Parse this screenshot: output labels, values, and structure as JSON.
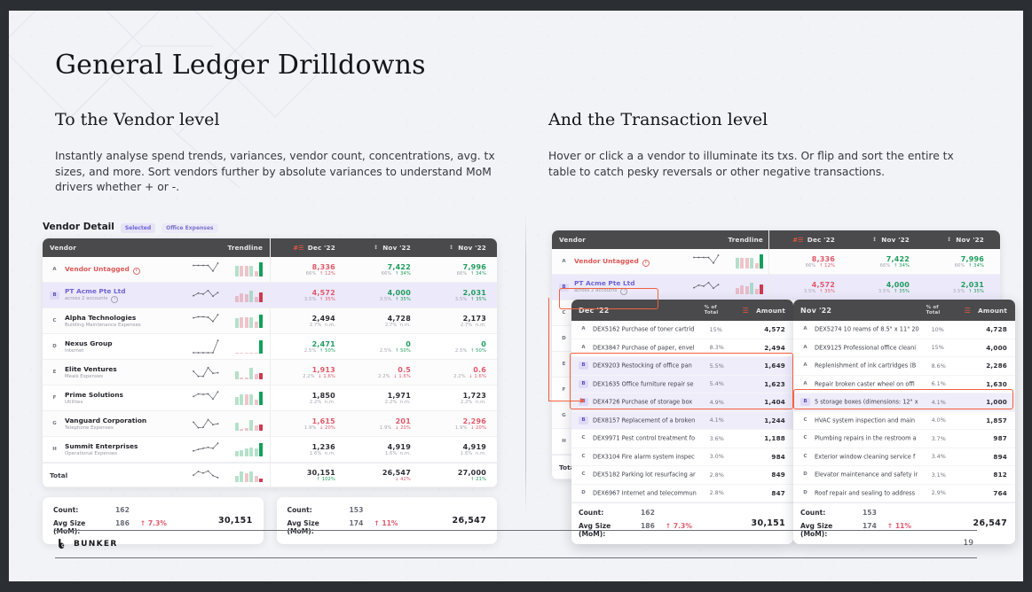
{
  "slide": {
    "title": "General Ledger Drilldowns",
    "page_number": "19",
    "brand": "BUNKER"
  },
  "left_col": {
    "heading": "To the Vendor level",
    "body": "Instantly analyse spend trends, variances, vendor count, concentrations, avg. tx sizes, and more. Sort vendors further by absolute variances to understand MoM drivers whether + or -."
  },
  "right_col": {
    "heading": "And the Transaction level",
    "body": "Hover or click a a vendor to illuminate its txs. Or flip and sort the entire tx table to catch pesky reversals or other negative transactions."
  },
  "vendor_detail": {
    "title": "Vendor Detail",
    "pill_selected": "Selected",
    "pill_category": "Office Expenses",
    "columns": {
      "vendor": "Vendor",
      "trendline": "Trendline",
      "col1": "Dec '22",
      "col2": "Nov '22",
      "col3": "Nov '22"
    },
    "sort_icon": "filter-sort-icon",
    "rows": [
      {
        "letter": "A",
        "name": "Vendor Untagged",
        "sub": "",
        "style": "red",
        "info": true,
        "c1": {
          "v": "8,336",
          "pct": "66%",
          "d": "↑ 12%",
          "tone": "red"
        },
        "c2": {
          "v": "7,422",
          "pct": "66%",
          "d": "↑ 34%",
          "tone": "green"
        },
        "c3": {
          "v": "7,996",
          "pct": "66%",
          "d": "↑ 34%",
          "tone": "green"
        }
      },
      {
        "letter": "B",
        "name": "PT Acme Pte Ltd",
        "sub": "across 2 accounts",
        "style": "purple",
        "info": true,
        "highlight": true,
        "c1": {
          "v": "4,572",
          "pct": "3.5%",
          "d": "↑ 35%",
          "tone": "red"
        },
        "c2": {
          "v": "4,000",
          "pct": "3.5%",
          "d": "↑ 35%",
          "tone": "green"
        },
        "c3": {
          "v": "2,031",
          "pct": "3.5%",
          "d": "↑ 35%",
          "tone": "green"
        }
      },
      {
        "letter": "C",
        "name": "Alpha Technologies",
        "sub": "Building Maintenance Expenses",
        "style": "dark",
        "c1": {
          "v": "2,494",
          "pct": "2.7%",
          "d": "n.m.",
          "tone": "dark"
        },
        "c2": {
          "v": "4,728",
          "pct": "2.7%",
          "d": "n.m.",
          "tone": "dark"
        },
        "c3": {
          "v": "2,173",
          "pct": "2.7%",
          "d": "n.m.",
          "tone": "dark"
        }
      },
      {
        "letter": "D",
        "name": "Nexus Group",
        "sub": "Internet",
        "style": "dark",
        "c1": {
          "v": "2,471",
          "pct": "2.5%",
          "d": "↑ 50%",
          "tone": "green"
        },
        "c2": {
          "v": "0",
          "pct": "2.5%",
          "d": "↑ 50%",
          "tone": "green"
        },
        "c3": {
          "v": "0",
          "pct": "2.5%",
          "d": "↑ 50%",
          "tone": "green"
        }
      },
      {
        "letter": "E",
        "name": "Elite Ventures",
        "sub": "Meals Expenses",
        "style": "dark",
        "c1": {
          "v": "1,913",
          "pct": "2.2%",
          "d": "↓ 1.6%",
          "tone": "red"
        },
        "c2": {
          "v": "0.5",
          "pct": "2.2%",
          "d": "↓ 1.6%",
          "tone": "red"
        },
        "c3": {
          "v": "0.6",
          "pct": "2.2%",
          "d": "↓ 1.6%",
          "tone": "red"
        }
      },
      {
        "letter": "F",
        "name": "Prime Solutions",
        "sub": "Utilities",
        "style": "dark",
        "c1": {
          "v": "1,850",
          "pct": "2.2%",
          "d": "n.m.",
          "tone": "dark"
        },
        "c2": {
          "v": "1,971",
          "pct": "2.2%",
          "d": "n.m.",
          "tone": "dark"
        },
        "c3": {
          "v": "1,723",
          "pct": "2.2%",
          "d": "n.m.",
          "tone": "dark"
        }
      },
      {
        "letter": "G",
        "name": "Vanguard Corporation",
        "sub": "Telephone Expenses",
        "style": "dark",
        "c1": {
          "v": "1,615",
          "pct": "1.9%",
          "d": "↓ 20%",
          "tone": "red"
        },
        "c2": {
          "v": "201",
          "pct": "1.9%",
          "d": "↓ 20%",
          "tone": "red"
        },
        "c3": {
          "v": "2,296",
          "pct": "1.9%",
          "d": "↓ 20%",
          "tone": "red"
        }
      },
      {
        "letter": "H",
        "name": "Summit Enterprises",
        "sub": "Operational Expenses",
        "style": "dark",
        "c1": {
          "v": "1,236",
          "pct": "1.6%",
          "d": "n.m.",
          "tone": "dark"
        },
        "c2": {
          "v": "4,919",
          "pct": "1.6%",
          "d": "n.m.",
          "tone": "dark"
        },
        "c3": {
          "v": "4,919",
          "pct": "1.6%",
          "d": "n.m.",
          "tone": "dark"
        }
      }
    ],
    "total": {
      "label": "Total",
      "c1": {
        "v": "30,151",
        "d": "↑ 102%",
        "tone": "green"
      },
      "c2": {
        "v": "26,547",
        "d": "↓ 42%",
        "tone": "red"
      },
      "c3": {
        "v": "27,000",
        "d": "↑ 21%",
        "tone": "green"
      }
    },
    "summary": [
      {
        "count_label": "Count:",
        "count_value": "162",
        "avg_label": "Avg Size (MoM):",
        "avg_value": "186",
        "avg_delta": "↑ 7.3%",
        "total": "30,151"
      },
      {
        "count_label": "Count:",
        "count_value": "153",
        "avg_label": "Avg Size (MoM):",
        "avg_value": "174",
        "avg_delta": "↑ 11%",
        "total": "26,547"
      }
    ]
  },
  "tx_tables": [
    {
      "header": {
        "period": "Dec '22",
        "pct_label": "% of\nTotal",
        "amount": "Amount",
        "sort_icon": "sort-desc-icon"
      },
      "rows": [
        {
          "letter": "A",
          "desc": "DEX5162 Purchase of toner cartrid",
          "pct": "15%",
          "amount": "4,572"
        },
        {
          "letter": "A",
          "desc": "DEX3847 Purchase of paper, envel",
          "pct": "8.3%",
          "amount": "2,494"
        },
        {
          "letter": "B",
          "desc": "DEX9203 Restocking of office pan",
          "pct": "5.5%",
          "amount": "1,649",
          "highlight": true
        },
        {
          "letter": "B",
          "desc": "DEX1635 Office furniture repair se",
          "pct": "5.4%",
          "amount": "1,623",
          "highlight": true
        },
        {
          "letter": "B",
          "desc": "DEX4726 Purchase of storage box",
          "pct": "4.9%",
          "amount": "1,404",
          "highlight": true
        },
        {
          "letter": "B",
          "desc": "DEX8157 Replacement of a broken",
          "pct": "4.1%",
          "amount": "1,244",
          "highlight": true
        },
        {
          "letter": "C",
          "desc": "DEX9971 Pest control treatment fo",
          "pct": "3.6%",
          "amount": "1,188"
        },
        {
          "letter": "C",
          "desc": "DEX3104 Fire alarm system inspec",
          "pct": "3.0%",
          "amount": "984"
        },
        {
          "letter": "C",
          "desc": "DEX5182 Parking lot resurfacing ar",
          "pct": "2.8%",
          "amount": "849"
        },
        {
          "letter": "D",
          "desc": "DEX6967 Internet and telecommun",
          "pct": "2.8%",
          "amount": "847"
        }
      ],
      "footer": {
        "count_label": "Count:",
        "count_value": "162",
        "avg_label": "Avg Size (MoM):",
        "avg_value": "186",
        "avg_delta": "↑ 7.3%",
        "total": "30,151"
      }
    },
    {
      "header": {
        "period": "Nov '22",
        "pct_label": "% of\nTotal",
        "amount": "Amount",
        "sort_icon": "sort-desc-icon"
      },
      "rows": [
        {
          "letter": "A",
          "desc": "DEX5274 10 reams of 8.5\" x 11\" 20",
          "pct": "10%",
          "amount": "4,728"
        },
        {
          "letter": "A",
          "desc": "DEX9125 Professional office cleani",
          "pct": "15%",
          "amount": "4,000"
        },
        {
          "letter": "A",
          "desc": "Replenishment of ink cartridges (B",
          "pct": "8.6%",
          "amount": "2,286"
        },
        {
          "letter": "A",
          "desc": "Repair broken caster wheel on offi",
          "pct": "6.1%",
          "amount": "1,630"
        },
        {
          "letter": "B",
          "desc": "5 storage boxes (dimensions: 12\" x",
          "pct": "4.1%",
          "amount": "1,000",
          "highlight": true
        },
        {
          "letter": "C",
          "desc": "HVAC system inspection and main",
          "pct": "4.0%",
          "amount": "1,857"
        },
        {
          "letter": "C",
          "desc": "Plumbing repairs in the restroom a",
          "pct": "3.7%",
          "amount": "987"
        },
        {
          "letter": "C",
          "desc": "Exterior window cleaning service f",
          "pct": "3.4%",
          "amount": "894"
        },
        {
          "letter": "D",
          "desc": "Elevator maintenance and safety ir",
          "pct": "3.1%",
          "amount": "812"
        },
        {
          "letter": "D",
          "desc": "Roof repair and sealing to address",
          "pct": "2.9%",
          "amount": "764"
        }
      ],
      "footer": {
        "count_label": "Count:",
        "count_value": "153",
        "avg_label": "Avg Size (MoM):",
        "avg_value": "174",
        "avg_delta": "↑ 11%",
        "total": "26,547"
      }
    }
  ],
  "colors": {
    "accent_red": "#e0596b",
    "accent_green": "#1e9d5d",
    "purple": "#6f63d8",
    "annotation": "#f4603c",
    "header_bg": "#4a4a4d",
    "slide_bg": "#f2f3f6"
  }
}
